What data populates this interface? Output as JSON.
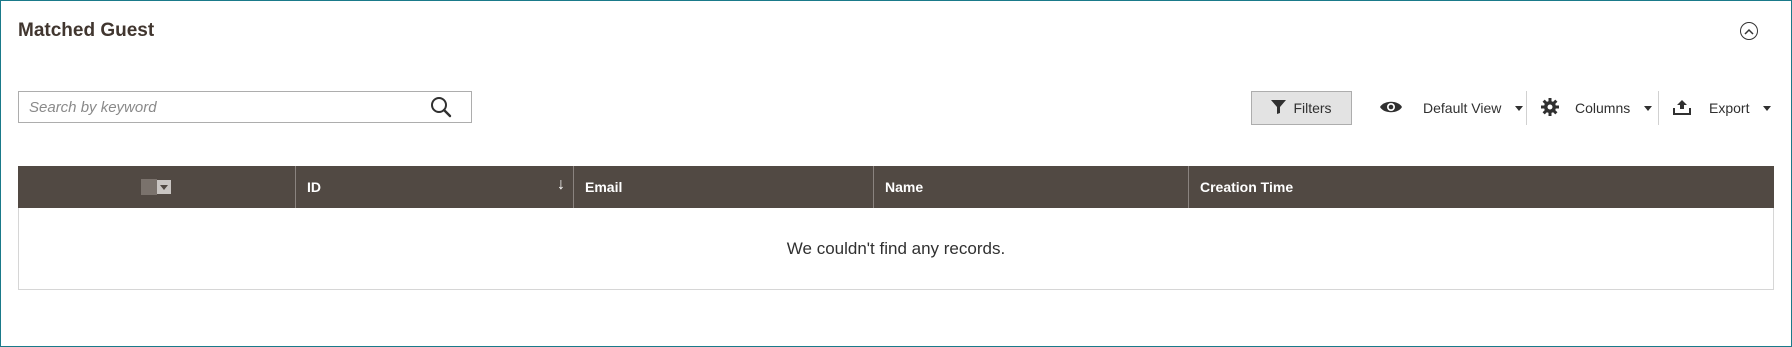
{
  "section": {
    "title": "Matched Guest"
  },
  "search": {
    "placeholder": "Search by keyword",
    "value": ""
  },
  "toolbar": {
    "filters_label": "Filters",
    "view_label": "Default View",
    "columns_label": "Columns",
    "export_label": "Export"
  },
  "grid": {
    "columns": [
      "ID",
      "Email",
      "Name",
      "Creation Time"
    ],
    "sort_indicator": "↓",
    "empty_message": "We couldn't find any records."
  },
  "colors": {
    "header_bg": "#514943",
    "frame_border": "#1a7a8a",
    "filters_bg": "#e3e3e3"
  }
}
